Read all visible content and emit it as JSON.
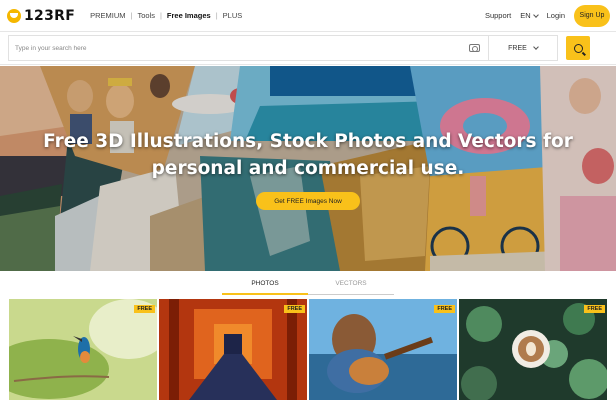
{
  "brand": {
    "logo_text": "123RF"
  },
  "nav": {
    "items": [
      "PREMIUM",
      "Tools",
      "Free Images",
      "PLUS"
    ],
    "active": "Free Images"
  },
  "header_right": {
    "support": "Support",
    "language": "EN",
    "login": "Login",
    "signup": "Sign Up"
  },
  "search": {
    "placeholder": "Type in your search here",
    "filter": "FREE"
  },
  "hero": {
    "headline_line1": "Free 3D Illustrations, Stock Photos and Vectors for",
    "headline_line2": "personal and commercial use.",
    "cta": "Get FREE Images Now"
  },
  "tabs": [
    "PHOTOS",
    "VECTORS"
  ],
  "active_tab": "PHOTOS",
  "thumbnails": [
    {
      "subject": "kingfisher-bird",
      "badge": "FREE"
    },
    {
      "subject": "torii-gate-corridor",
      "badge": "FREE"
    },
    {
      "subject": "woman-playing-guitar",
      "badge": "FREE"
    },
    {
      "subject": "latte-art-with-succulents",
      "badge": "FREE"
    }
  ],
  "colors": {
    "accent": "#f9c11a",
    "text": "#222222"
  }
}
